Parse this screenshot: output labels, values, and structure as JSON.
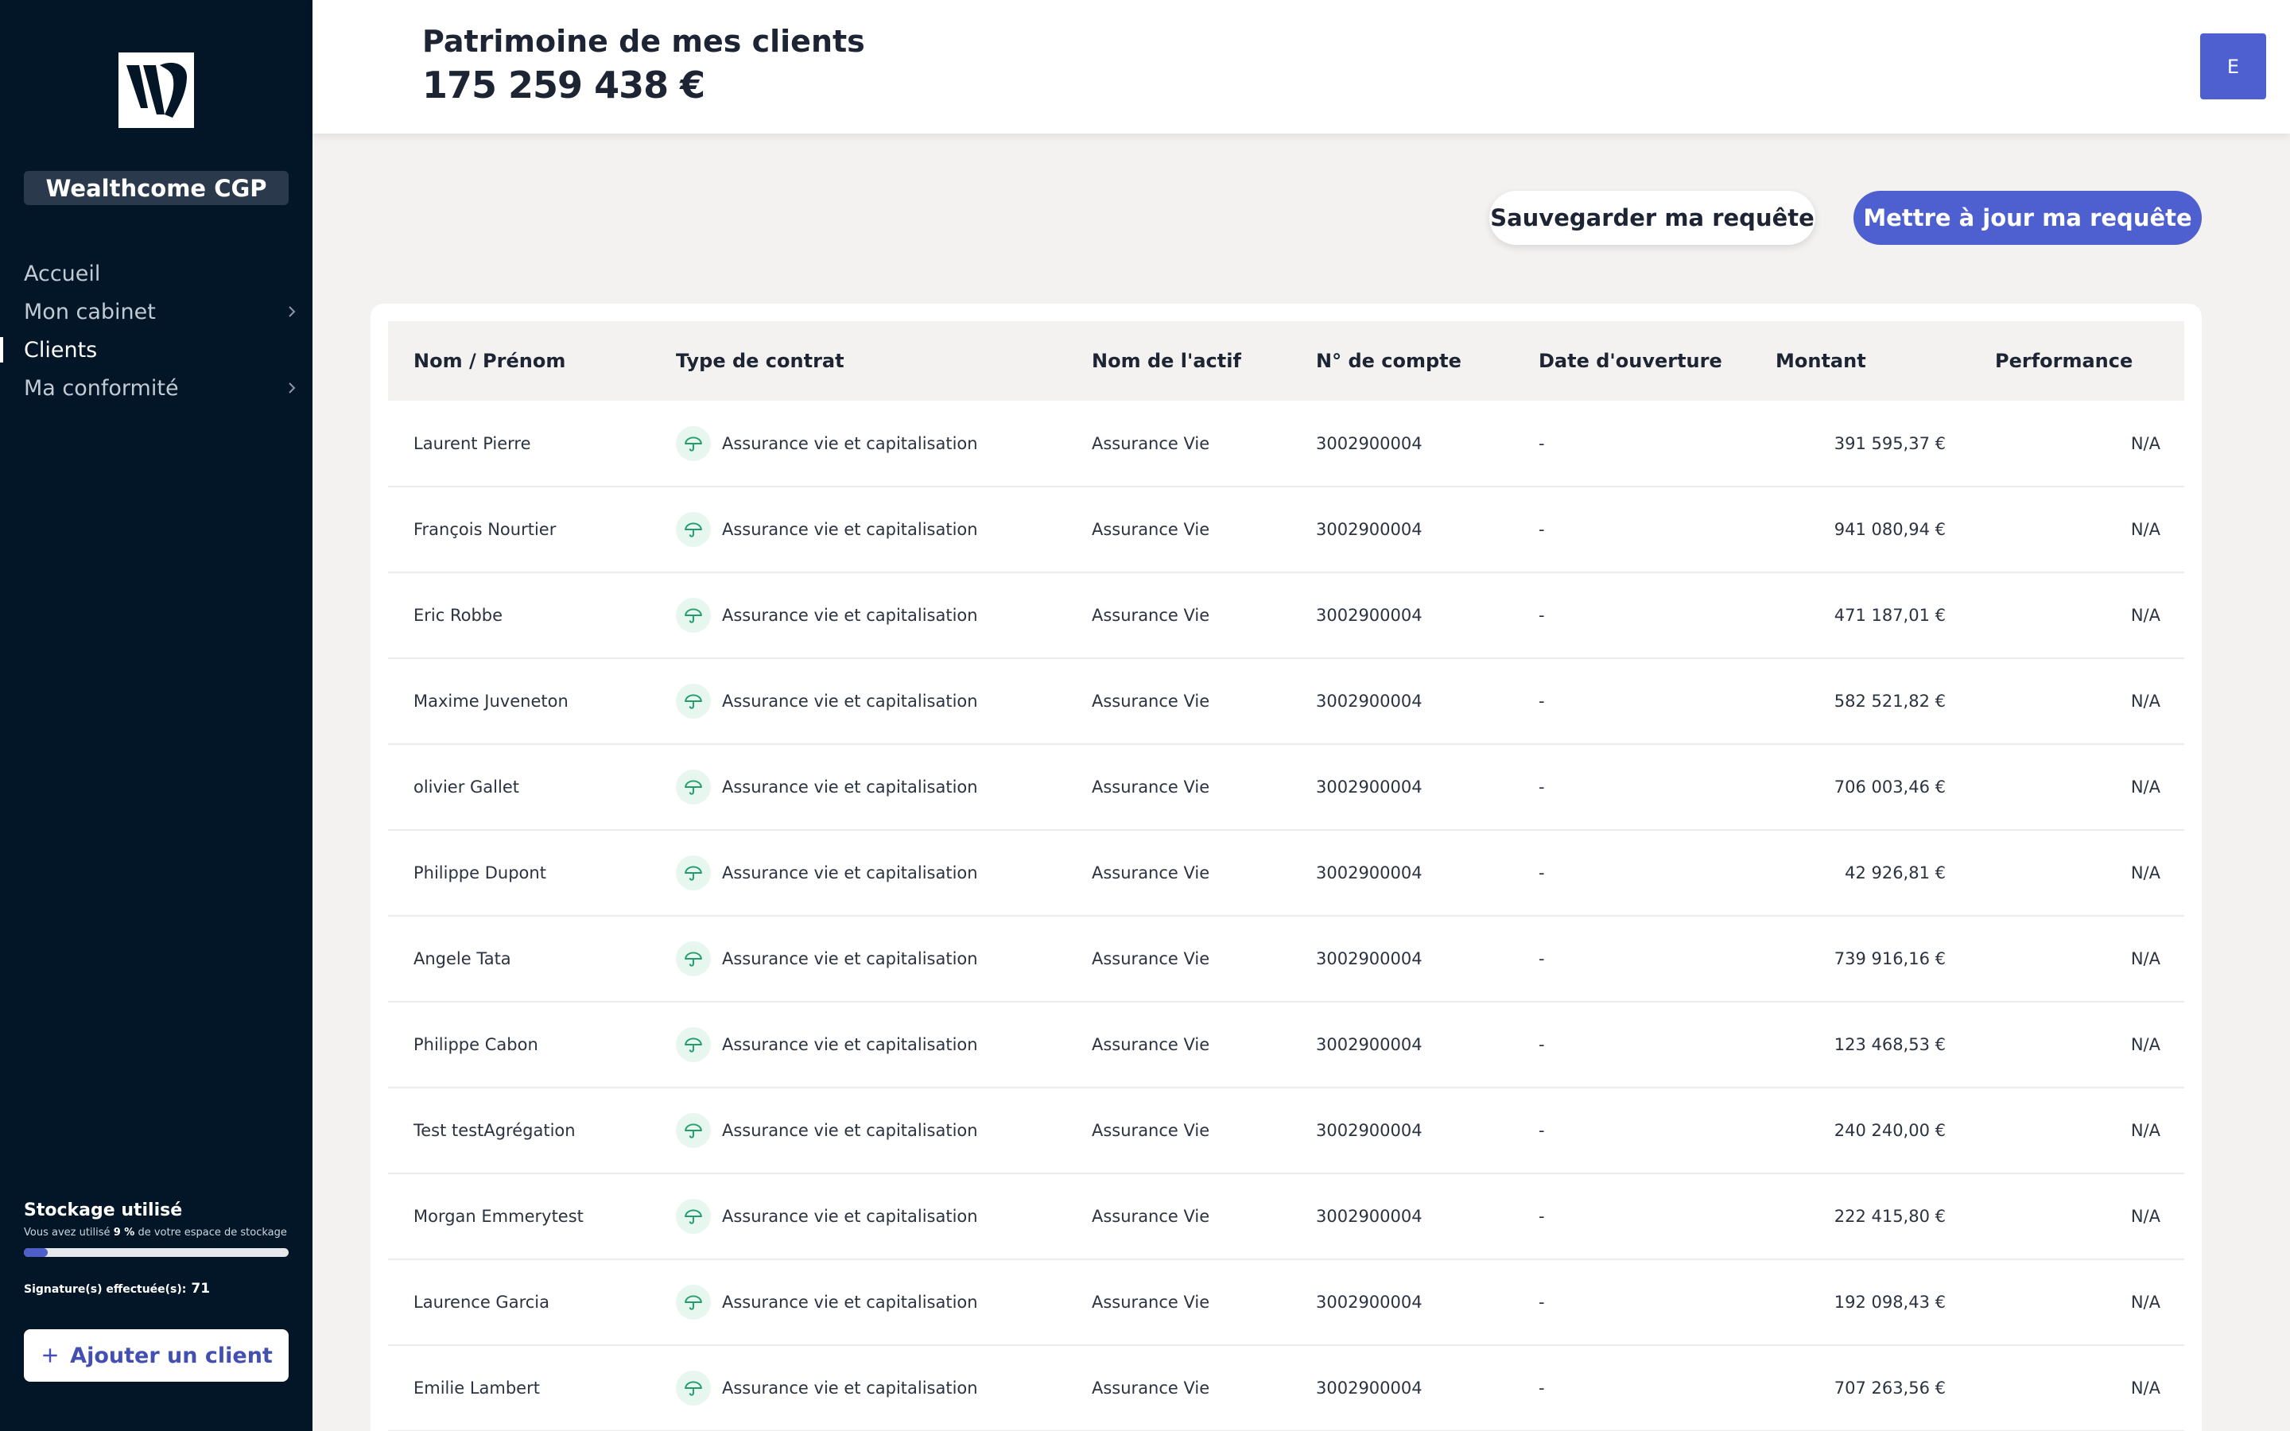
{
  "sidebar": {
    "brand": "Wealthcome CGP",
    "nav": [
      {
        "label": "Accueil",
        "active": false,
        "chevron": false
      },
      {
        "label": "Mon cabinet",
        "active": false,
        "chevron": true
      },
      {
        "label": "Clients",
        "active": true,
        "chevron": false
      },
      {
        "label": "Ma conformité",
        "active": false,
        "chevron": true
      }
    ],
    "storage": {
      "title": "Stockage utilisé",
      "desc_prefix": "Vous avez utilisé",
      "percent": "9 %",
      "desc_suffix": "de votre espace de stockage",
      "progress_percent": 9
    },
    "signatures": {
      "label": "Signature(s) effectuée(s):",
      "count": "71"
    },
    "add_client": "Ajouter un client"
  },
  "header": {
    "title": "Patrimoine de mes clients",
    "total": "175 259 438 €",
    "avatar": "E"
  },
  "actions": {
    "save": "Sauvegarder ma requête",
    "update": "Mettre à jour ma requête"
  },
  "table": {
    "columns": [
      "Nom / Prénom",
      "Type de contrat",
      "Nom de l'actif",
      "N° de compte",
      "Date d'ouverture",
      "Montant",
      "Performance"
    ],
    "rows": [
      {
        "name": "Laurent Pierre",
        "contract": "Assurance vie et capitalisation",
        "asset": "Assurance Vie",
        "account": "3002900004",
        "date": "-",
        "amount": "391 595,37 €",
        "performance": "N/A"
      },
      {
        "name": "François Nourtier",
        "contract": "Assurance vie et capitalisation",
        "asset": "Assurance Vie",
        "account": "3002900004",
        "date": "-",
        "amount": "941 080,94 €",
        "performance": "N/A"
      },
      {
        "name": "Eric Robbe",
        "contract": "Assurance vie et capitalisation",
        "asset": "Assurance Vie",
        "account": "3002900004",
        "date": "-",
        "amount": "471 187,01 €",
        "performance": "N/A"
      },
      {
        "name": "Maxime Juveneton",
        "contract": "Assurance vie et capitalisation",
        "asset": "Assurance Vie",
        "account": "3002900004",
        "date": "-",
        "amount": "582 521,82 €",
        "performance": "N/A"
      },
      {
        "name": "olivier Gallet",
        "contract": "Assurance vie et capitalisation",
        "asset": "Assurance Vie",
        "account": "3002900004",
        "date": "-",
        "amount": "706 003,46 €",
        "performance": "N/A"
      },
      {
        "name": "Philippe Dupont",
        "contract": "Assurance vie et capitalisation",
        "asset": "Assurance Vie",
        "account": "3002900004",
        "date": "-",
        "amount": "42 926,81 €",
        "performance": "N/A"
      },
      {
        "name": "Angele Tata",
        "contract": "Assurance vie et capitalisation",
        "asset": "Assurance Vie",
        "account": "3002900004",
        "date": "-",
        "amount": "739 916,16 €",
        "performance": "N/A"
      },
      {
        "name": "Philippe Cabon",
        "contract": "Assurance vie et capitalisation",
        "asset": "Assurance Vie",
        "account": "3002900004",
        "date": "-",
        "amount": "123 468,53 €",
        "performance": "N/A"
      },
      {
        "name": "Test testAgrégation",
        "contract": "Assurance vie et capitalisation",
        "asset": "Assurance Vie",
        "account": "3002900004",
        "date": "-",
        "amount": "240 240,00 €",
        "performance": "N/A"
      },
      {
        "name": "Morgan Emmerytest",
        "contract": "Assurance vie et capitalisation",
        "asset": "Assurance Vie",
        "account": "3002900004",
        "date": "-",
        "amount": "222 415,80 €",
        "performance": "N/A"
      },
      {
        "name": "Laurence Garcia",
        "contract": "Assurance vie et capitalisation",
        "asset": "Assurance Vie",
        "account": "3002900004",
        "date": "-",
        "amount": "192 098,43 €",
        "performance": "N/A"
      },
      {
        "name": "Emilie Lambert",
        "contract": "Assurance vie et capitalisation",
        "asset": "Assurance Vie",
        "account": "3002900004",
        "date": "-",
        "amount": "707 263,56 €",
        "performance": "N/A"
      }
    ]
  },
  "colors": {
    "sidebar_bg": "#031628",
    "accent": "#4e5fcf",
    "contract_icon": "#1f9e6a",
    "icons": {
      "contract": "umbrella-icon",
      "nav": "chevron-right-icon",
      "add": "plus-icon"
    }
  }
}
